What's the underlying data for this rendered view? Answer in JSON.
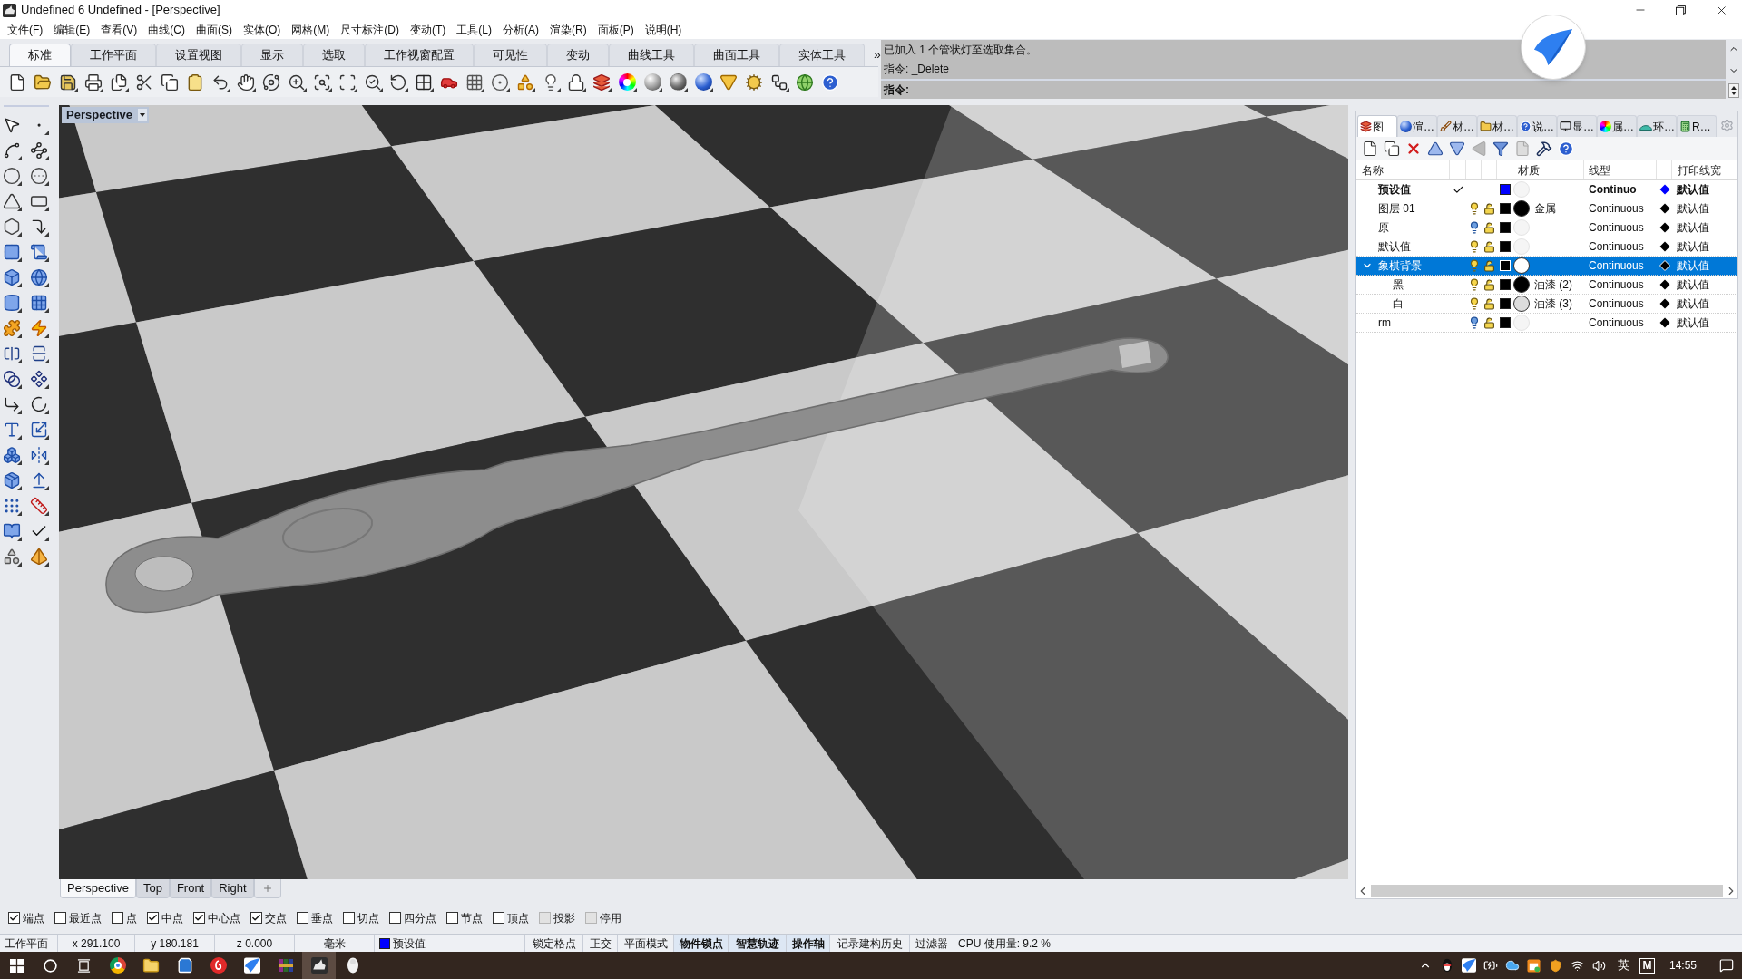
{
  "window": {
    "title": "Undefined 6 Undefined - [Perspective]"
  },
  "menu": [
    "文件(F)",
    "编辑(E)",
    "查看(V)",
    "曲线(C)",
    "曲面(S)",
    "实体(O)",
    "网格(M)",
    "尺寸标注(D)",
    "变动(T)",
    "工具(L)",
    "分析(A)",
    "渲染(R)",
    "面板(P)",
    "说明(H)"
  ],
  "toolbar_tabs": [
    {
      "label": "标准",
      "selected": true
    },
    {
      "label": "工作平面",
      "selected": false
    },
    {
      "label": "设置视图",
      "selected": false
    },
    {
      "label": "显示",
      "selected": false
    },
    {
      "label": "选取",
      "selected": false
    },
    {
      "label": "工作视窗配置",
      "selected": false
    },
    {
      "label": "可见性",
      "selected": false
    },
    {
      "label": "变动",
      "selected": false
    },
    {
      "label": "曲线工具",
      "selected": false
    },
    {
      "label": "曲面工具",
      "selected": false
    },
    {
      "label": "实体工具",
      "selected": false
    }
  ],
  "toolbar_overflow": "»",
  "command": {
    "history": [
      "已加入 1 个管状灯至选取集合。",
      "指令: _Delete"
    ],
    "prompt": "指令:"
  },
  "viewport": {
    "label": "Perspective"
  },
  "viewport_tabs": [
    {
      "label": "Perspective",
      "selected": true
    },
    {
      "label": "Top",
      "selected": false
    },
    {
      "label": "Front",
      "selected": false
    },
    {
      "label": "Right",
      "selected": false
    }
  ],
  "panel": {
    "tabs": [
      {
        "label": "图",
        "selected": true
      },
      {
        "label": "渲…",
        "selected": false
      },
      {
        "label": "材…",
        "selected": false
      },
      {
        "label": "材…",
        "selected": false
      },
      {
        "label": "说…",
        "selected": false
      },
      {
        "label": "显…",
        "selected": false
      },
      {
        "label": "属…",
        "selected": false
      },
      {
        "label": "环…",
        "selected": false
      },
      {
        "label": "R…",
        "selected": false
      }
    ],
    "columns": [
      "名称",
      "材质",
      "线型",
      "打印线宽"
    ],
    "layers": [
      {
        "name": "预设值",
        "current": true,
        "selected": false,
        "color": "#0000ff",
        "linetype": "Continuo",
        "print_width": {
          "color": "#0000ff",
          "label": "默认值"
        }
      },
      {
        "name": "图层 01",
        "current": false,
        "selected": false,
        "visible": true,
        "locked": false,
        "color": "#000000",
        "material": {
          "color": "#000000",
          "name": "金属"
        },
        "linetype": "Continuous",
        "print_width": {
          "color": "#000000",
          "label": "默认值"
        }
      },
      {
        "name": "原",
        "current": false,
        "selected": false,
        "visible": false,
        "locked": false,
        "color": "#000000",
        "linetype": "Continuous",
        "print_width": {
          "color": "#000000",
          "label": "默认值"
        }
      },
      {
        "name": "默认值",
        "current": false,
        "selected": false,
        "visible": true,
        "locked": false,
        "color": "#000000",
        "linetype": "Continuous",
        "print_width": {
          "color": "#000000",
          "label": "默认值"
        }
      },
      {
        "name": "象棋背景",
        "current": false,
        "selected": true,
        "expanded": true,
        "visible": true,
        "locked": false,
        "color": "#000000",
        "material": {
          "color": "#ffffff"
        },
        "linetype": "Continuous",
        "print_width": {
          "color": "#000000",
          "label": "默认值"
        },
        "children": [
          {
            "name": "黑",
            "current": false,
            "selected": false,
            "visible": true,
            "locked": false,
            "color": "#000000",
            "material": {
              "color": "#000000",
              "name": "油漆 (2)"
            },
            "linetype": "Continuous",
            "print_width": {
              "color": "#000000",
              "label": "默认值"
            }
          },
          {
            "name": "白",
            "current": false,
            "selected": false,
            "visible": true,
            "locked": false,
            "color": "#000000",
            "material": {
              "color": "#dddddd",
              "name": "油漆 (3)"
            },
            "linetype": "Continuous",
            "print_width": {
              "color": "#000000",
              "label": "默认值"
            }
          }
        ]
      },
      {
        "name": "rm",
        "current": false,
        "selected": false,
        "visible": false,
        "locked": false,
        "color": "#000000",
        "linetype": "Continuous",
        "print_width": {
          "color": "#000000",
          "label": "默认值"
        }
      }
    ]
  },
  "osnaps": [
    {
      "label": "端点",
      "checked": true,
      "disabled": false
    },
    {
      "label": "最近点",
      "checked": false,
      "disabled": false
    },
    {
      "label": "点",
      "checked": false,
      "disabled": false
    },
    {
      "label": "中点",
      "checked": true,
      "disabled": false
    },
    {
      "label": "中心点",
      "checked": true,
      "disabled": false
    },
    {
      "label": "交点",
      "checked": true,
      "disabled": false
    },
    {
      "label": "垂点",
      "checked": false,
      "disabled": false
    },
    {
      "label": "切点",
      "checked": false,
      "disabled": false
    },
    {
      "label": "四分点",
      "checked": false,
      "disabled": false
    },
    {
      "label": "节点",
      "checked": false,
      "disabled": false
    },
    {
      "label": "顶点",
      "checked": false,
      "disabled": false
    },
    {
      "label": "投影",
      "checked": false,
      "disabled": true
    },
    {
      "label": "停用",
      "checked": false,
      "disabled": true
    }
  ],
  "status_bar": {
    "cplane": "工作平面",
    "x": "x 291.100",
    "y": "y 180.181",
    "z": "z 0.000",
    "units": "毫米",
    "layer": {
      "label": "预设值",
      "color": "#0000ff"
    },
    "toggles": [
      {
        "label": "锁定格点",
        "on": false
      },
      {
        "label": "正交",
        "on": false
      },
      {
        "label": "平面模式",
        "on": false
      },
      {
        "label": "物件锁点",
        "on": true
      },
      {
        "label": "智慧轨迹",
        "on": true
      },
      {
        "label": "操作轴",
        "on": true
      },
      {
        "label": "记录建构历史",
        "on": false
      },
      {
        "label": "过滤器",
        "on": false
      }
    ],
    "cpu": "CPU 使用量: 9.2 %"
  },
  "taskbar": {
    "apps": [
      {
        "selected": false
      },
      {
        "selected": false
      },
      {
        "selected": false
      },
      {
        "selected": false
      },
      {
        "selected": false
      },
      {
        "selected": false
      },
      {
        "selected": true
      },
      {
        "selected": false
      }
    ],
    "language": "英",
    "ime": "M",
    "time": "14:55"
  }
}
